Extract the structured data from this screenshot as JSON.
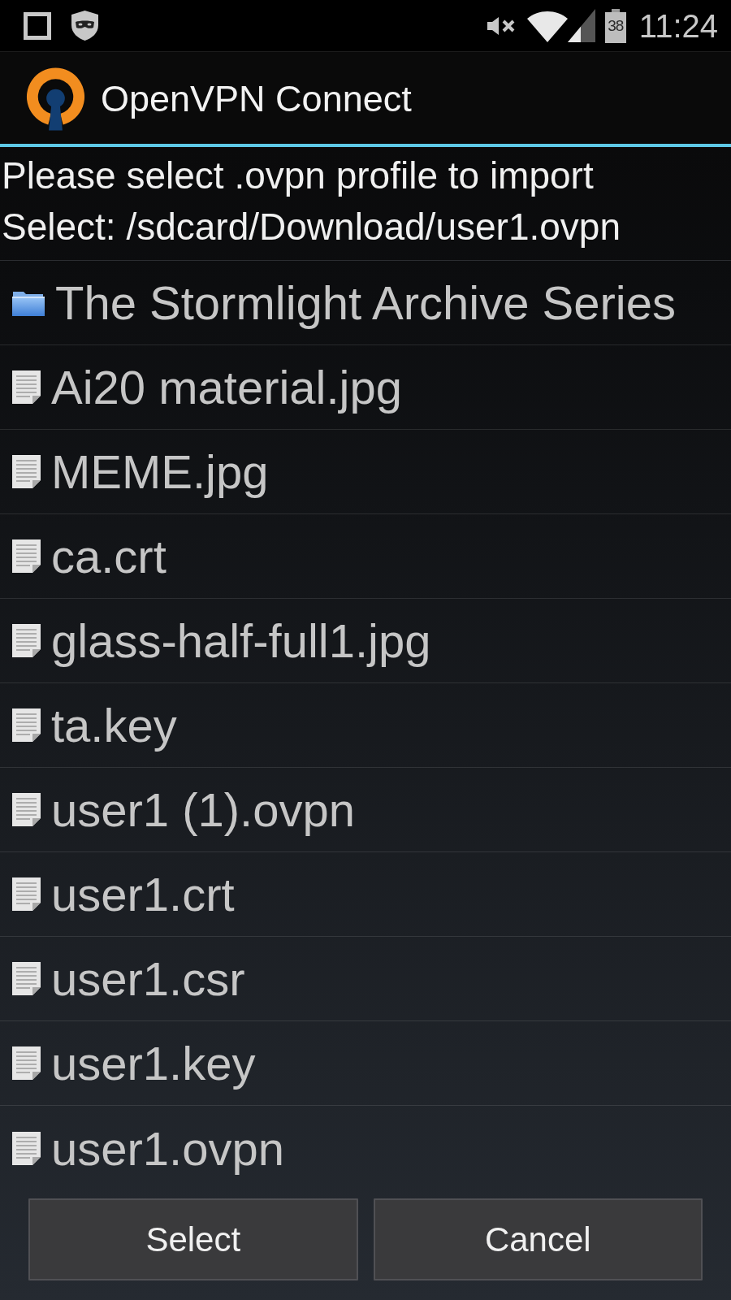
{
  "status_bar": {
    "battery_percent": "38",
    "time": "11:24"
  },
  "app_bar": {
    "title": "OpenVPN Connect"
  },
  "prompt": {
    "title": "Please select .ovpn profile to import",
    "selection": "Select: /sdcard/Download/user1.ovpn"
  },
  "files": [
    {
      "kind": "folder",
      "name": "The Stormlight Archive Series",
      "selected": false
    },
    {
      "kind": "file",
      "name": "Ai20 material.jpg",
      "selected": false
    },
    {
      "kind": "file",
      "name": "MEME.jpg",
      "selected": false
    },
    {
      "kind": "file",
      "name": "ca.crt",
      "selected": false
    },
    {
      "kind": "file",
      "name": "glass-half-full1.jpg",
      "selected": false
    },
    {
      "kind": "file",
      "name": "ta.key",
      "selected": false
    },
    {
      "kind": "file",
      "name": "user1 (1).ovpn",
      "selected": false
    },
    {
      "kind": "file",
      "name": "user1.crt",
      "selected": false
    },
    {
      "kind": "file",
      "name": "user1.csr",
      "selected": false
    },
    {
      "kind": "file",
      "name": "user1.key",
      "selected": false
    },
    {
      "kind": "file",
      "name": "user1.ovpn",
      "selected": false
    }
  ],
  "buttons": [
    {
      "label": "Select"
    },
    {
      "label": "Cancel"
    }
  ]
}
